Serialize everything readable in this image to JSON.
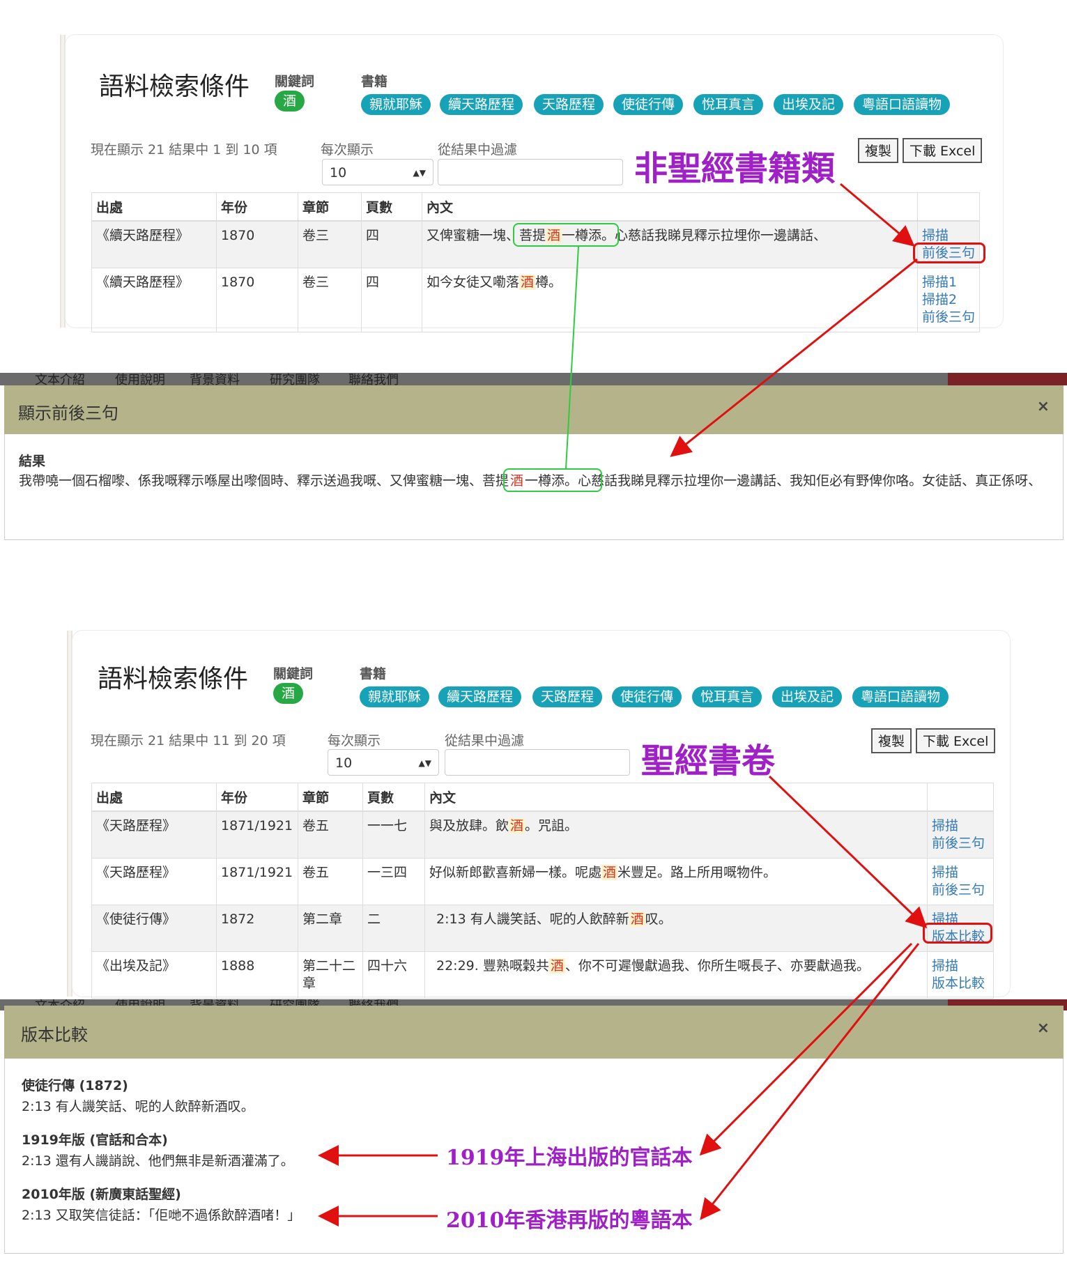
{
  "panel1": {
    "title": "語料檢索條件",
    "keyword_label": "關鍵詞",
    "keyword": "酒",
    "books_label": "書籍",
    "books": [
      "親就耶穌",
      "續天路歷程",
      "天路歷程",
      "使徒行傳",
      "悅耳真言",
      "出埃及記",
      "粵語口語讀物"
    ],
    "info": "現在顯示 21 結果中 1 到 10 項",
    "per_page_label": "每次顯示",
    "per_page_value": "10",
    "filter_label": "從結果中過濾",
    "copy_btn": "複製",
    "excel_btn": "下載 Excel",
    "columns": [
      "出處",
      "年份",
      "章節",
      "頁數",
      "內文",
      ""
    ],
    "rows": [
      {
        "source": "《續天路歷程》",
        "year": "1870",
        "chapter": "卷三",
        "page": "四",
        "pre": "又俾蜜糖一塊、菩提",
        "kw": "酒",
        "post": "一樽添。心慈話我睇見釋示拉埋你一邊講話、",
        "links": [
          "掃描",
          "前後三句"
        ]
      },
      {
        "source": "《續天路歷程》",
        "year": "1870",
        "chapter": "卷三",
        "page": "四",
        "pre": "如今女徒又嘞落",
        "kw": "酒",
        "post": "樽。",
        "links": [
          "掃描1",
          "掃描2",
          "前後三句"
        ]
      }
    ]
  },
  "annotation_nonbible": "非聖經書籍類",
  "nav_items": [
    "文本介紹",
    "使用說明",
    "背景資料",
    "研究團隊",
    "聯絡我們"
  ],
  "modal1": {
    "title": "顯示前後三句",
    "close": "×",
    "result_label": "結果",
    "text_pre": "我帶嘵一個石榴嚟、係我嘅釋示喺屋出嚟個時、釋示送過我嘅、又俾蜜糖一塊、",
    "text_hl_pre": "菩提",
    "text_kw": "酒",
    "text_hl_post": "一樽添。",
    "text_post": "心慈話我睇見釋示拉埋你一邊講話、我知佢必有野俾你咯。女徒話、真正係呀、"
  },
  "panel2": {
    "title": "語料檢索條件",
    "keyword_label": "關鍵詞",
    "keyword": "酒",
    "books_label": "書籍",
    "books": [
      "親就耶穌",
      "續天路歷程",
      "天路歷程",
      "使徒行傳",
      "悅耳真言",
      "出埃及記",
      "粵語口語讀物"
    ],
    "info": "現在顯示 21 結果中 11 到 20 項",
    "per_page_label": "每次顯示",
    "per_page_value": "10",
    "filter_label": "從結果中過濾",
    "copy_btn": "複製",
    "excel_btn": "下載 Excel",
    "columns": [
      "出處",
      "年份",
      "章節",
      "頁數",
      "內文",
      ""
    ],
    "rows": [
      {
        "source": "《天路歷程》",
        "year": "1871/1921",
        "chapter": "卷五",
        "page": "一一七",
        "pre": "與及放肆。飲",
        "kw": "酒",
        "post": "。咒詛。",
        "links": [
          "掃描",
          "前後三句"
        ]
      },
      {
        "source": "《天路歷程》",
        "year": "1871/1921",
        "chapter": "卷五",
        "page": "一三四",
        "pre": "好似新郎歡喜新婦一樣。呢處",
        "kw": "酒",
        "post": "米豐足。路上所用嘅物件。",
        "links": [
          "掃描",
          "前後三句"
        ]
      },
      {
        "source": "《使徒行傳》",
        "year": "1872",
        "chapter": "第二章",
        "page": "二",
        "pre": "2:13 有人譏笑話、呢的人飲醉新",
        "kw": "酒",
        "post": "叹。",
        "links": [
          "掃描",
          "版本比較"
        ]
      },
      {
        "source": "《出埃及記》",
        "year": "1888",
        "chapter": "第二十二章",
        "page": "四十六",
        "pre": "22:29. 豐熟嘅穀共",
        "kw": "酒",
        "post": "、你不可遲慢獻過我、你所生嘅長子、亦要獻過我。",
        "links": [
          "掃描",
          "版本比較"
        ]
      }
    ]
  },
  "annotation_bible": "聖經書卷",
  "modal2": {
    "title": "版本比較",
    "close": "×",
    "blocks": [
      {
        "heading": "使徒行傳 (1872)",
        "text": "2:13 有人譏笑話、呢的人飲醉新酒叹。"
      },
      {
        "heading": "1919年版 (官話和合本)",
        "text": "2:13 還有人譏誚說、他們無非是新酒灌滿了。"
      },
      {
        "heading": "2010年版 (新廣東話聖經)",
        "text": "2:13 又取笑信徒話：「佢哋不過係飲醉酒啫！」"
      }
    ]
  },
  "annotation_1919": "1919年上海出版的官話本",
  "annotation_2010": "2010年香港再版的粵語本",
  "colors": {
    "pill": "#17a2b8",
    "keyword_pill": "#28a745",
    "modal_header": "#b5b38a",
    "annotation": "#a020c8",
    "arrow_red": "#e01010",
    "highlight_green": "#2ecc40",
    "link": "#337ab7"
  }
}
